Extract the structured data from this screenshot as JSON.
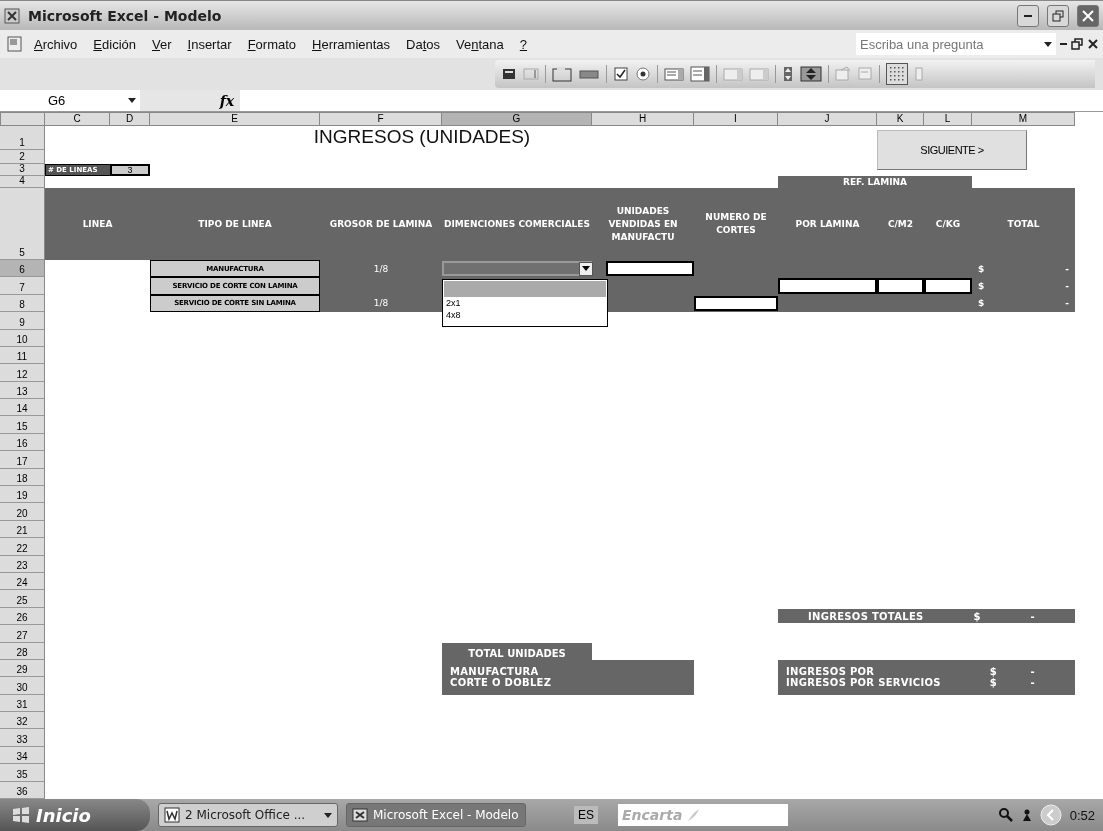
{
  "window": {
    "title": "Microsoft Excel - Modelo"
  },
  "menu": {
    "items": [
      {
        "access_key": "A",
        "after": "rchivo"
      },
      {
        "access_key": "E",
        "after": "dición"
      },
      {
        "access_key": "V",
        "after": "er"
      },
      {
        "access_key": "I",
        "after": "nsertar"
      },
      {
        "access_key": "F",
        "after": "ormato"
      },
      {
        "access_key": "H",
        "after": "erramientas"
      },
      {
        "before": "Da",
        "access_key": "t",
        "after": "os"
      },
      {
        "before": "Ve",
        "access_key": "n",
        "after": "tana"
      },
      {
        "access_key": "?"
      }
    ],
    "help_placeholder": "Escriba una pregunta"
  },
  "formula_bar": {
    "cell": "G6",
    "fx": "fx"
  },
  "columns": [
    {
      "label": "C",
      "selected": false
    },
    {
      "label": "D",
      "selected": false
    },
    {
      "label": "E",
      "selected": false
    },
    {
      "label": "F",
      "selected": false
    },
    {
      "label": "G",
      "selected": true
    },
    {
      "label": "H",
      "selected": false
    },
    {
      "label": "I",
      "selected": false
    },
    {
      "label": "J",
      "selected": false
    },
    {
      "label": "K",
      "selected": false
    },
    {
      "label": "L",
      "selected": false
    },
    {
      "label": "M",
      "selected": false
    }
  ],
  "rows": [
    {
      "label": "1",
      "selected": false
    },
    {
      "label": "2",
      "selected": false
    },
    {
      "label": "3",
      "selected": false
    },
    {
      "label": "4",
      "selected": false
    },
    {
      "label": "5",
      "selected": false
    },
    {
      "label": "6",
      "selected": true
    },
    {
      "label": "7",
      "selected": false
    },
    {
      "label": "8",
      "selected": false
    },
    {
      "label": "9",
      "selected": false
    },
    {
      "label": "10",
      "selected": false
    },
    {
      "label": "11",
      "selected": false
    },
    {
      "label": "12",
      "selected": false
    },
    {
      "label": "13",
      "selected": false
    },
    {
      "label": "14",
      "selected": false
    },
    {
      "label": "15",
      "selected": false
    },
    {
      "label": "16",
      "selected": false
    },
    {
      "label": "17",
      "selected": false
    },
    {
      "label": "18",
      "selected": false
    },
    {
      "label": "19",
      "selected": false
    },
    {
      "label": "20",
      "selected": false
    },
    {
      "label": "21",
      "selected": false
    },
    {
      "label": "22",
      "selected": false
    },
    {
      "label": "23",
      "selected": false
    },
    {
      "label": "24",
      "selected": false
    },
    {
      "label": "25",
      "selected": false
    },
    {
      "label": "26",
      "selected": false
    },
    {
      "label": "27",
      "selected": false
    },
    {
      "label": "28",
      "selected": false
    },
    {
      "label": "29",
      "selected": false
    },
    {
      "label": "30",
      "selected": false
    },
    {
      "label": "31",
      "selected": false
    },
    {
      "label": "32",
      "selected": false
    },
    {
      "label": "33",
      "selected": false
    },
    {
      "label": "34",
      "selected": false
    },
    {
      "label": "35",
      "selected": false
    },
    {
      "label": "36",
      "selected": false
    }
  ],
  "sheet": {
    "title": "INGRESOS (UNIDADES)",
    "next_button": "SIGUIENTE >",
    "line_count": {
      "label": "# DE LINEAS",
      "value": "3"
    },
    "group_header": "REF. LAMINA",
    "headers": [
      "LINEA",
      "TIPO DE LINEA",
      "GROSOR DE LAMINA",
      "DIMENCIONES COMERCIALES",
      "UNIDADES VENDIDAS EN MANUFACTU",
      "NUMERO DE CORTES",
      "POR LAMINA",
      "C/M2",
      "C/KG",
      "TOTAL"
    ],
    "lines": [
      {
        "type": "MANUFACTURA",
        "thickness": "1/8",
        "inputs": [
          {
            "kind": "dimension"
          },
          {
            "kind": "units"
          }
        ],
        "currency": "$",
        "total": "-"
      },
      {
        "type": "SERVICIO DE CORTE CON LAMINA",
        "inputs": [
          {
            "kind": "prices"
          }
        ],
        "currency": "$",
        "total": "-"
      },
      {
        "type": "SERVICIO DE CORTE SIN LAMINA",
        "thickness": "1/8",
        "inputs": [
          {
            "kind": "cuts"
          }
        ],
        "currency": "$",
        "total": "-"
      }
    ],
    "dropdown": {
      "highlight_blank": true,
      "options": [
        {
          "label": "2x1",
          "selected": false
        },
        {
          "label": "4x8",
          "selected": false
        }
      ]
    },
    "income_total": {
      "label": "INGRESOS TOTALES",
      "currency": "$",
      "value": "-"
    },
    "total_units": {
      "title": "TOTAL UNIDADES",
      "rows": [
        "MANUFACTURA",
        "CORTE O DOBLEZ"
      ]
    },
    "income_rows": [
      {
        "label": "INGRESOS POR",
        "currency": "$",
        "value": "-"
      },
      {
        "label": "INGRESOS POR SERVICIOS",
        "currency": "$",
        "value": "-"
      }
    ]
  },
  "taskbar": {
    "start": "Inicio",
    "tasks": [
      {
        "label": "2 Microsoft Office ...",
        "kind": "group",
        "selected": false
      },
      {
        "label": "Microsoft Excel - Modelo",
        "kind": "window",
        "selected": true
      }
    ],
    "language": "ES",
    "search_placeholder": "Encarta",
    "clock": "0:52"
  }
}
